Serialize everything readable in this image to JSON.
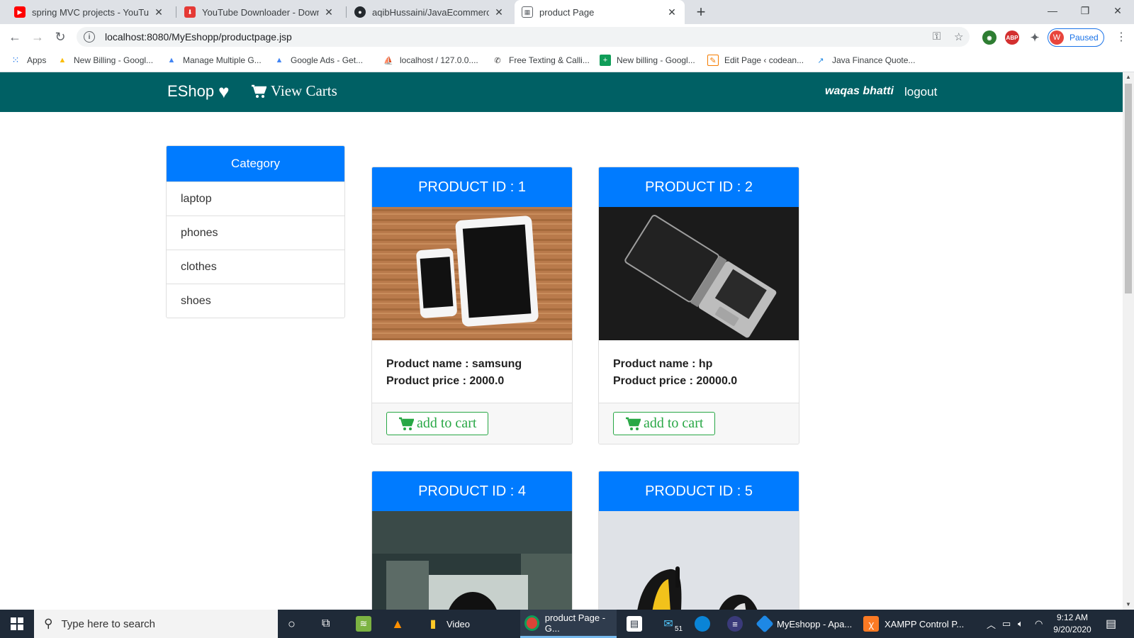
{
  "browser": {
    "tabs": [
      {
        "title": "spring MVC projects - YouTube",
        "favicon": "youtube-icon",
        "color": "#ff0000"
      },
      {
        "title": "YouTube Downloader - Downloa",
        "favicon": "download-icon",
        "color": "#e53935"
      },
      {
        "title": "aqibHussaini/JavaEcommerceWe",
        "favicon": "github-icon",
        "color": "#24292e"
      },
      {
        "title": "product Page",
        "favicon": "page-icon",
        "color": "#5f6368"
      }
    ],
    "url": "localhost:8080/MyEshopp/productpage.jsp",
    "profile_initial": "W",
    "profile_status": "Paused",
    "bookmarks": [
      {
        "label": "Apps",
        "icon": "apps-grid-icon"
      },
      {
        "label": "New Billing - Googl...",
        "icon": "google-drive-icon"
      },
      {
        "label": "Manage Multiple G...",
        "icon": "google-ads-icon"
      },
      {
        "label": "Google Ads - Get...",
        "icon": "google-ads-icon"
      },
      {
        "label": "localhost / 127.0.0....",
        "icon": "phpmyadmin-icon"
      },
      {
        "label": "Free Texting & Calli...",
        "icon": "phone-icon"
      },
      {
        "label": "New billing - Googl...",
        "icon": "google-sheets-icon"
      },
      {
        "label": "Edit Page ‹ codean...",
        "icon": "edit-page-icon"
      },
      {
        "label": "Java Finance Quote...",
        "icon": "chart-icon"
      }
    ]
  },
  "site": {
    "brand": "EShop",
    "view_carts": "View Carts",
    "username": "waqas bhatti",
    "logout": "logout",
    "accent": "#007bff",
    "navbar_color": "#006064",
    "success_color": "#28a745"
  },
  "category": {
    "title": "Category",
    "items": [
      "laptop",
      "phones",
      "clothes",
      "shoes"
    ]
  },
  "products": [
    {
      "header": "PRODUCT ID : 1",
      "name": "Product name : samsung",
      "price": "Product price : 2000.0",
      "button": "add to cart"
    },
    {
      "header": "PRODUCT ID : 2",
      "name": "Product name : hp",
      "price": "Product price : 20000.0",
      "button": "add to cart"
    },
    {
      "header": "PRODUCT ID : 4"
    },
    {
      "header": "PRODUCT ID : 5"
    }
  ],
  "taskbar": {
    "search_placeholder": "Type here to search",
    "apps": [
      {
        "label": "Video",
        "icon": "folder-icon"
      },
      {
        "label": "product Page - G...",
        "icon": "chrome-icon"
      },
      {
        "label": "MyEshopp - Apa...",
        "icon": "netbeans-icon"
      },
      {
        "label": "XAMPP Control P...",
        "icon": "xampp-icon"
      }
    ],
    "mail_badge": "51",
    "time": "9:12 AM",
    "date": "9/20/2020"
  }
}
